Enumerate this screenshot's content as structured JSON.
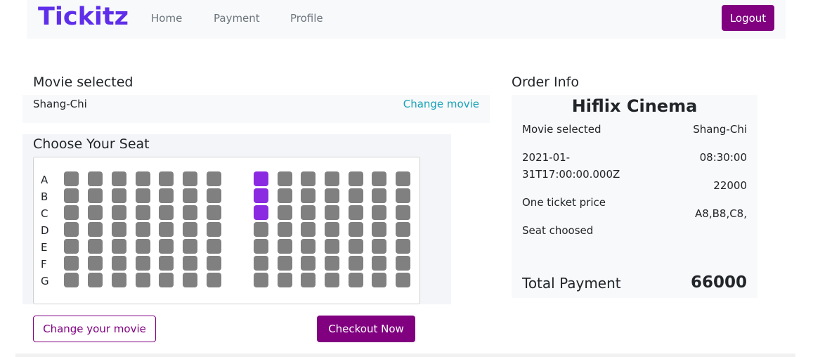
{
  "nav": {
    "brand": "Tickitz",
    "links": [
      "Home",
      "Payment",
      "Profile"
    ],
    "logout_label": "Logout",
    "brand_color": "#5f2eea",
    "accent_color": "#800080"
  },
  "movie_section": {
    "title": "Movie selected",
    "movie_name": "Shang-Chi",
    "change_label": "Change movie"
  },
  "seat_section": {
    "title": "Choose Your Seat",
    "rows": [
      "A",
      "B",
      "C",
      "D",
      "E",
      "F",
      "G"
    ],
    "seats_per_row": 14,
    "selected": [
      "A8",
      "B8",
      "C8"
    ],
    "seat_color": "#808080",
    "selected_color": "#8a2be2"
  },
  "order": {
    "title": "Order Info",
    "cinema": "Hiflix Cinema",
    "movie_label": "Movie selected",
    "movie_value": "Shang-Chi",
    "date_line1": "2021-01-",
    "date_line2": "31T17:00:00.000Z",
    "time_value": "08:30:00",
    "price_value": "22000",
    "price_label": "One ticket price",
    "seats_value": "A8,B8,C8,",
    "seats_label": "Seat choosed",
    "total_label": "Total Payment",
    "total_value": "66000"
  },
  "actions": {
    "change_movie_label": "Change your movie",
    "checkout_label": "Checkout Now"
  }
}
